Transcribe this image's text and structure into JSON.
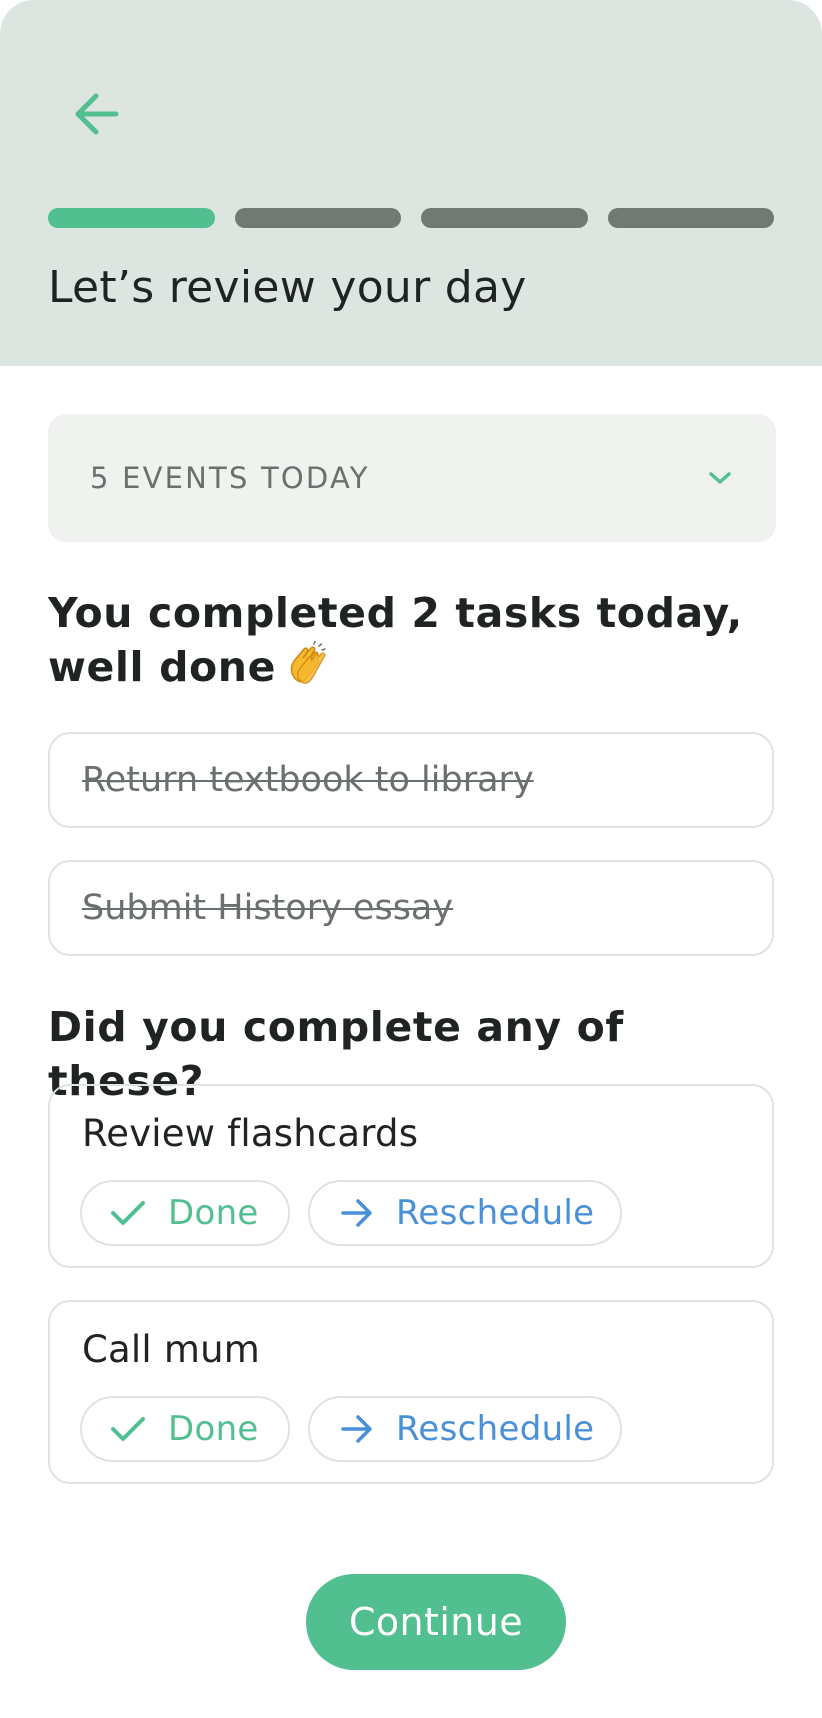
{
  "header": {
    "back_icon": "arrow-left-icon",
    "progress": {
      "total_steps": 4,
      "current_step": 1
    },
    "title": "Let’s review your day"
  },
  "events_dropdown": {
    "label": "5 EVENTS TODAY",
    "icon": "chevron-down-icon"
  },
  "completed": {
    "heading": "You completed 2 tasks today, well done",
    "emoji": "👏",
    "tasks": [
      {
        "label": "Return textbook to library"
      },
      {
        "label": "Submit History essay"
      }
    ]
  },
  "pending": {
    "heading": "Did you complete any of these?",
    "tasks": [
      {
        "label": "Review flashcards",
        "done_label": "Done",
        "reschedule_label": "Reschedule"
      },
      {
        "label": "Call mum",
        "done_label": "Done",
        "reschedule_label": "Reschedule"
      }
    ]
  },
  "continue_label": "Continue",
  "colors": {
    "accent": "#52bf90",
    "header_bg": "#dce5df",
    "progress_inactive": "#727874",
    "reschedule": "#4a90d9",
    "muted_text": "#6a706c"
  }
}
